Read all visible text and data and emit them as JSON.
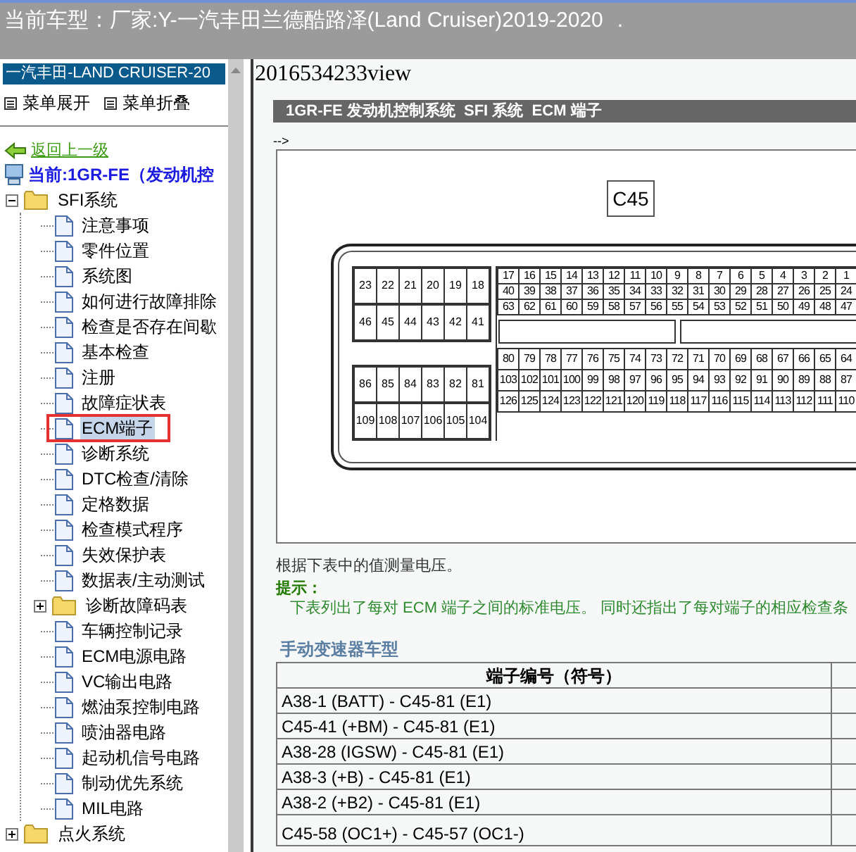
{
  "header": {
    "label": "当前车型：",
    "value": "厂家:Y-一汽丰田兰德酷路泽(Land Cruiser)2019-2020",
    "mark": "."
  },
  "sidebar": {
    "title": "一汽丰田-LAND CRUISER-20",
    "menu": [
      "菜单展开",
      "菜单折叠"
    ],
    "back_link": "返回上一级",
    "current": "当前:1GR-FE（发动机控",
    "tree": [
      {
        "label": "SFI系统",
        "kind": "folder",
        "expanded": true,
        "selected": false,
        "children": [
          {
            "label": "注意事项",
            "kind": "page",
            "selected": false
          },
          {
            "label": "零件位置",
            "kind": "page",
            "selected": false
          },
          {
            "label": "系统图",
            "kind": "page",
            "selected": false
          },
          {
            "label": "如何进行故障排除",
            "kind": "page",
            "selected": false
          },
          {
            "label": "检查是否存在间歇",
            "kind": "page",
            "selected": false
          },
          {
            "label": "基本检查",
            "kind": "page",
            "selected": false
          },
          {
            "label": "注册",
            "kind": "page",
            "selected": false
          },
          {
            "label": "故障症状表",
            "kind": "page",
            "selected": false
          },
          {
            "label": "ECM端子",
            "kind": "page",
            "selected": true
          },
          {
            "label": "诊断系统",
            "kind": "page",
            "selected": false
          },
          {
            "label": "DTC检查/清除",
            "kind": "page",
            "selected": false
          },
          {
            "label": "定格数据",
            "kind": "page",
            "selected": false
          },
          {
            "label": "检查模式程序",
            "kind": "page",
            "selected": false
          },
          {
            "label": "失效保护表",
            "kind": "page",
            "selected": false
          },
          {
            "label": "数据表/主动测试",
            "kind": "page",
            "selected": false
          },
          {
            "label": "诊断故障码表",
            "kind": "folder",
            "expanded": false,
            "selected": false
          },
          {
            "label": "车辆控制记录",
            "kind": "page",
            "selected": false
          },
          {
            "label": "ECM电源电路",
            "kind": "page",
            "selected": false
          },
          {
            "label": "VC输出电路",
            "kind": "page",
            "selected": false
          },
          {
            "label": "燃油泵控制电路",
            "kind": "page",
            "selected": false
          },
          {
            "label": "喷油器电路",
            "kind": "page",
            "selected": false
          },
          {
            "label": "起动机信号电路",
            "kind": "page",
            "selected": false
          },
          {
            "label": "制动优先系统",
            "kind": "page",
            "selected": false
          },
          {
            "label": "MIL电路",
            "kind": "page",
            "selected": false
          }
        ]
      },
      {
        "label": "点火系统",
        "kind": "folder",
        "expanded": false,
        "selected": false
      }
    ]
  },
  "content": {
    "page_title": "2016534233view",
    "section_title": "1GR-FE 发动机控制系统  SFI 系统  ECM 端子",
    "comment": "-->",
    "connector": {
      "label": "C45",
      "left_pins": [
        [
          "23",
          "22",
          "21",
          "20",
          "19",
          "18"
        ],
        [
          "46",
          "45",
          "44",
          "43",
          "42",
          "41"
        ],
        [
          "86",
          "85",
          "84",
          "83",
          "82",
          "81"
        ],
        [
          "109",
          "108",
          "107",
          "106",
          "105",
          "104"
        ]
      ],
      "right_pins": [
        [
          "17",
          "16",
          "15",
          "14",
          "13",
          "12",
          "11",
          "10",
          "9",
          "8",
          "7",
          "6",
          "5",
          "4",
          "3",
          "2",
          "1"
        ],
        [
          "40",
          "39",
          "38",
          "37",
          "36",
          "35",
          "34",
          "33",
          "32",
          "31",
          "30",
          "29",
          "28",
          "27",
          "26",
          "25",
          "24"
        ],
        [
          "63",
          "62",
          "61",
          "60",
          "59",
          "58",
          "57",
          "56",
          "55",
          "54",
          "53",
          "52",
          "51",
          "50",
          "49",
          "48",
          "47"
        ],
        [
          "80",
          "79",
          "78",
          "77",
          "76",
          "75",
          "74",
          "73",
          "72",
          "71",
          "70",
          "69",
          "68",
          "67",
          "66",
          "65",
          "64"
        ],
        [
          "103",
          "102",
          "101",
          "100",
          "99",
          "98",
          "97",
          "96",
          "95",
          "94",
          "93",
          "92",
          "91",
          "90",
          "89",
          "88",
          "87"
        ],
        [
          "126",
          "125",
          "124",
          "123",
          "122",
          "121",
          "120",
          "119",
          "118",
          "117",
          "116",
          "115",
          "114",
          "113",
          "112",
          "111",
          "110"
        ]
      ]
    },
    "instruction": "根据下表中的值测量电压。",
    "hint_label": "提示：",
    "hint_text": "下表列出了每对 ECM 端子之间的标准电压。 同时还指出了每对端子的相应检查条",
    "table_title": "手动变速器车型",
    "table": {
      "columns": [
        "端子编号（符号）"
      ],
      "rows": [
        [
          "A38-1 (BATT) - C45-81 (E1)"
        ],
        [
          "C45-41 (+BM) - C45-81 (E1)"
        ],
        [
          "A38-28 (IGSW) - C45-81 (E1)"
        ],
        [
          "A38-3 (+B) - C45-81 (E1)"
        ],
        [
          "A38-2 (+B2) - C45-81 (E1)"
        ],
        [
          "C45-58 (OC1+) - C45-57 (OC1-)"
        ]
      ]
    }
  }
}
